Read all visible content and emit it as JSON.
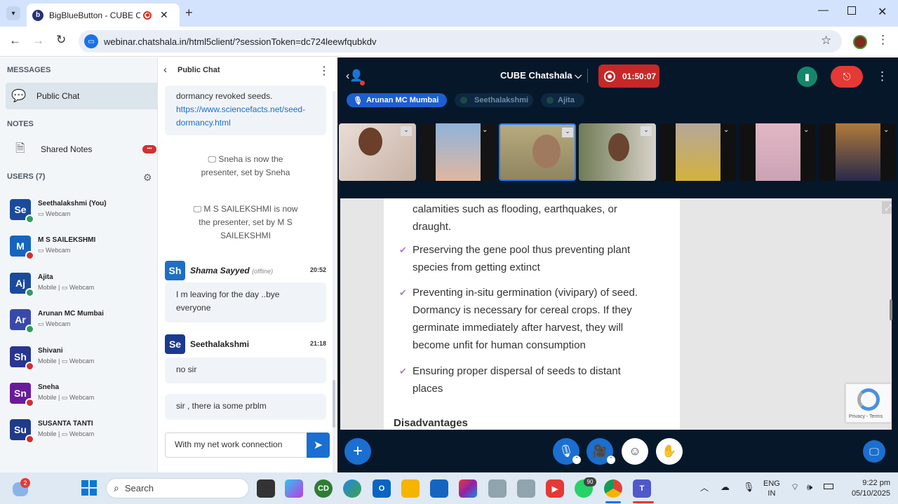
{
  "browser": {
    "tab_title": "BigBlueButton - CUBE Chats",
    "url": "webinar.chatshala.in/html5client/?sessionToken=dc724leewfqubkdv"
  },
  "left_panel": {
    "messages_heading": "MESSAGES",
    "public_chat_label": "Public Chat",
    "notes_heading": "NOTES",
    "shared_notes_label": "Shared Notes",
    "shared_notes_badge": "•••",
    "users_heading": "USERS (7)",
    "users": [
      {
        "initials": "Se",
        "name": "Seethalakshmi (You)",
        "status": "▭ Webcam",
        "color": "#1a4a9c",
        "dot": "#2e9e5b"
      },
      {
        "initials": "M",
        "name": "M S SAILEKSHMI",
        "status": "▭ Webcam",
        "color": "#1565c0",
        "dot": "#d32f2f"
      },
      {
        "initials": "Aj",
        "name": "Ajita",
        "status": "Mobile | ▭ Webcam",
        "color": "#1a4a9c",
        "dot": "#2e9e5b"
      },
      {
        "initials": "Ar",
        "name": "Arunan MC Mumbai",
        "status": "▭ Webcam",
        "color": "#3949ab",
        "dot": "#2e9e5b"
      },
      {
        "initials": "Sh",
        "name": "Shivani",
        "status": "Mobile | ▭ Webcam",
        "color": "#283593",
        "dot": "#d32f2f"
      },
      {
        "initials": "Sn",
        "name": "Sneha",
        "status": "Mobile | ▭ Webcam",
        "color": "#6a1b9a",
        "dot": "#d32f2f"
      },
      {
        "initials": "Su",
        "name": "SUSANTA TANTI",
        "status": "Mobile | ▭ Webcam",
        "color": "#1e3a8a",
        "dot": "#d32f2f"
      }
    ]
  },
  "chat": {
    "title": "Public Chat",
    "msg1_text": "dormancy revoked seeds.",
    "msg1_link_a": "https://www.sciencefacts.net/seed-",
    "msg1_link_b": "dormancy.html",
    "sys1_line1": "🖵 Sneha is now the",
    "sys1_line2": "presenter, set by Sneha",
    "sys2_line1": "🖵 M S SAILEKSHMI is now",
    "sys2_line2": "the presenter, set by M S",
    "sys2_line3": "SAILEKSHMI",
    "m2_initials": "Sh",
    "m2_name": "Shama Sayyed",
    "m2_offline": "(offline)",
    "m2_time": "20:52",
    "m2_text_a": "I m leaving for the day ..bye",
    "m2_text_b": "everyone",
    "m3_initials": "Se",
    "m3_name": "Seethalakshmi",
    "m3_time": "21:18",
    "m3_text1": "no sir",
    "m3_text2": "sir , there ia some prblm",
    "input_value": "With my net work connection"
  },
  "meeting": {
    "title": "CUBE Chatshala",
    "timer": "01:50:07",
    "talker_active": "Arunan MC Mumbai",
    "talker_2": "Seethalakshmi",
    "talker_3": "Ajita",
    "slide_lines": {
      "l0a": "calamities such as flooding, earthquakes, or",
      "l0b": "draught.",
      "b1a": "Preserving the gene pool thus preventing plant",
      "b1b": "species from getting extinct",
      "b2a": "Preventing in-situ germination (vivipary) of seed.",
      "b2b": "Dormancy is necessary for cereal crops. If they",
      "b2c": "germinate immediately after harvest, they will",
      "b2d": "become unfit for human consumption",
      "b3a": "Ensuring proper dispersal of seeds to distant",
      "b3b": "places",
      "heading": "Disadvantages"
    },
    "recaptcha_text": "Privacy - Terms"
  },
  "taskbar": {
    "search_placeholder": "Search",
    "lang_top": "ENG",
    "lang_bottom": "IN",
    "time": "9:22 pm",
    "date": "05/10/2025",
    "weather_badge": "2",
    "whatsapp_badge": "90"
  }
}
